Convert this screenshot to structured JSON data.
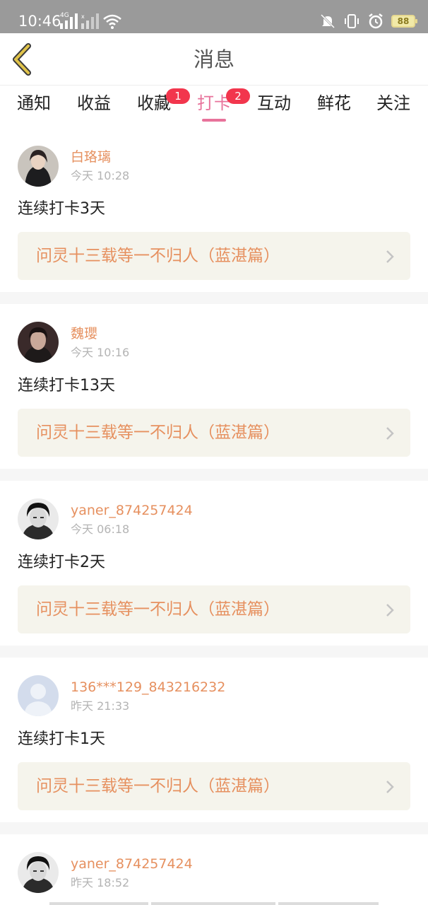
{
  "status_bar": {
    "time": "10:46",
    "network": "4G",
    "battery": "88"
  },
  "header": {
    "title": "消息"
  },
  "tabs": [
    {
      "label": "通知",
      "badge": ""
    },
    {
      "label": "收益",
      "badge": ""
    },
    {
      "label": "收藏",
      "badge": "1"
    },
    {
      "label": "打卡",
      "badge": "2",
      "active": true
    },
    {
      "label": "互动",
      "badge": ""
    },
    {
      "label": "鲜花",
      "badge": ""
    },
    {
      "label": "关注",
      "badge": ""
    }
  ],
  "messages": [
    {
      "name": "白珞璃",
      "time": "今天 10:28",
      "text": "连续打卡3天",
      "book": "问灵十三载等一不归人（蓝湛篇）"
    },
    {
      "name": "魏瓔",
      "time": "今天 10:16",
      "text": "连续打卡13天",
      "book": "问灵十三载等一不归人（蓝湛篇）"
    },
    {
      "name": "yaner_874257424",
      "time": "今天 06:18",
      "text": "连续打卡2天",
      "book": "问灵十三载等一不归人（蓝湛篇）"
    },
    {
      "name": "136***129_843216232",
      "time": "昨天 21:33",
      "text": "连续打卡1天",
      "book": "问灵十三载等一不归人（蓝湛篇）"
    },
    {
      "name": "yaner_874257424",
      "time": "昨天 18:52",
      "text": "",
      "book": ""
    }
  ],
  "colors": {
    "accent": "#e8739b",
    "name": "#e6905f",
    "badge": "#f2364d",
    "book_bg": "#f5f4ec"
  },
  "icons": [
    "back-arrow-icon",
    "signal-icon",
    "wifi-icon",
    "mute-icon",
    "vibrate-icon",
    "alarm-icon",
    "battery-icon",
    "chevron-right-icon"
  ]
}
